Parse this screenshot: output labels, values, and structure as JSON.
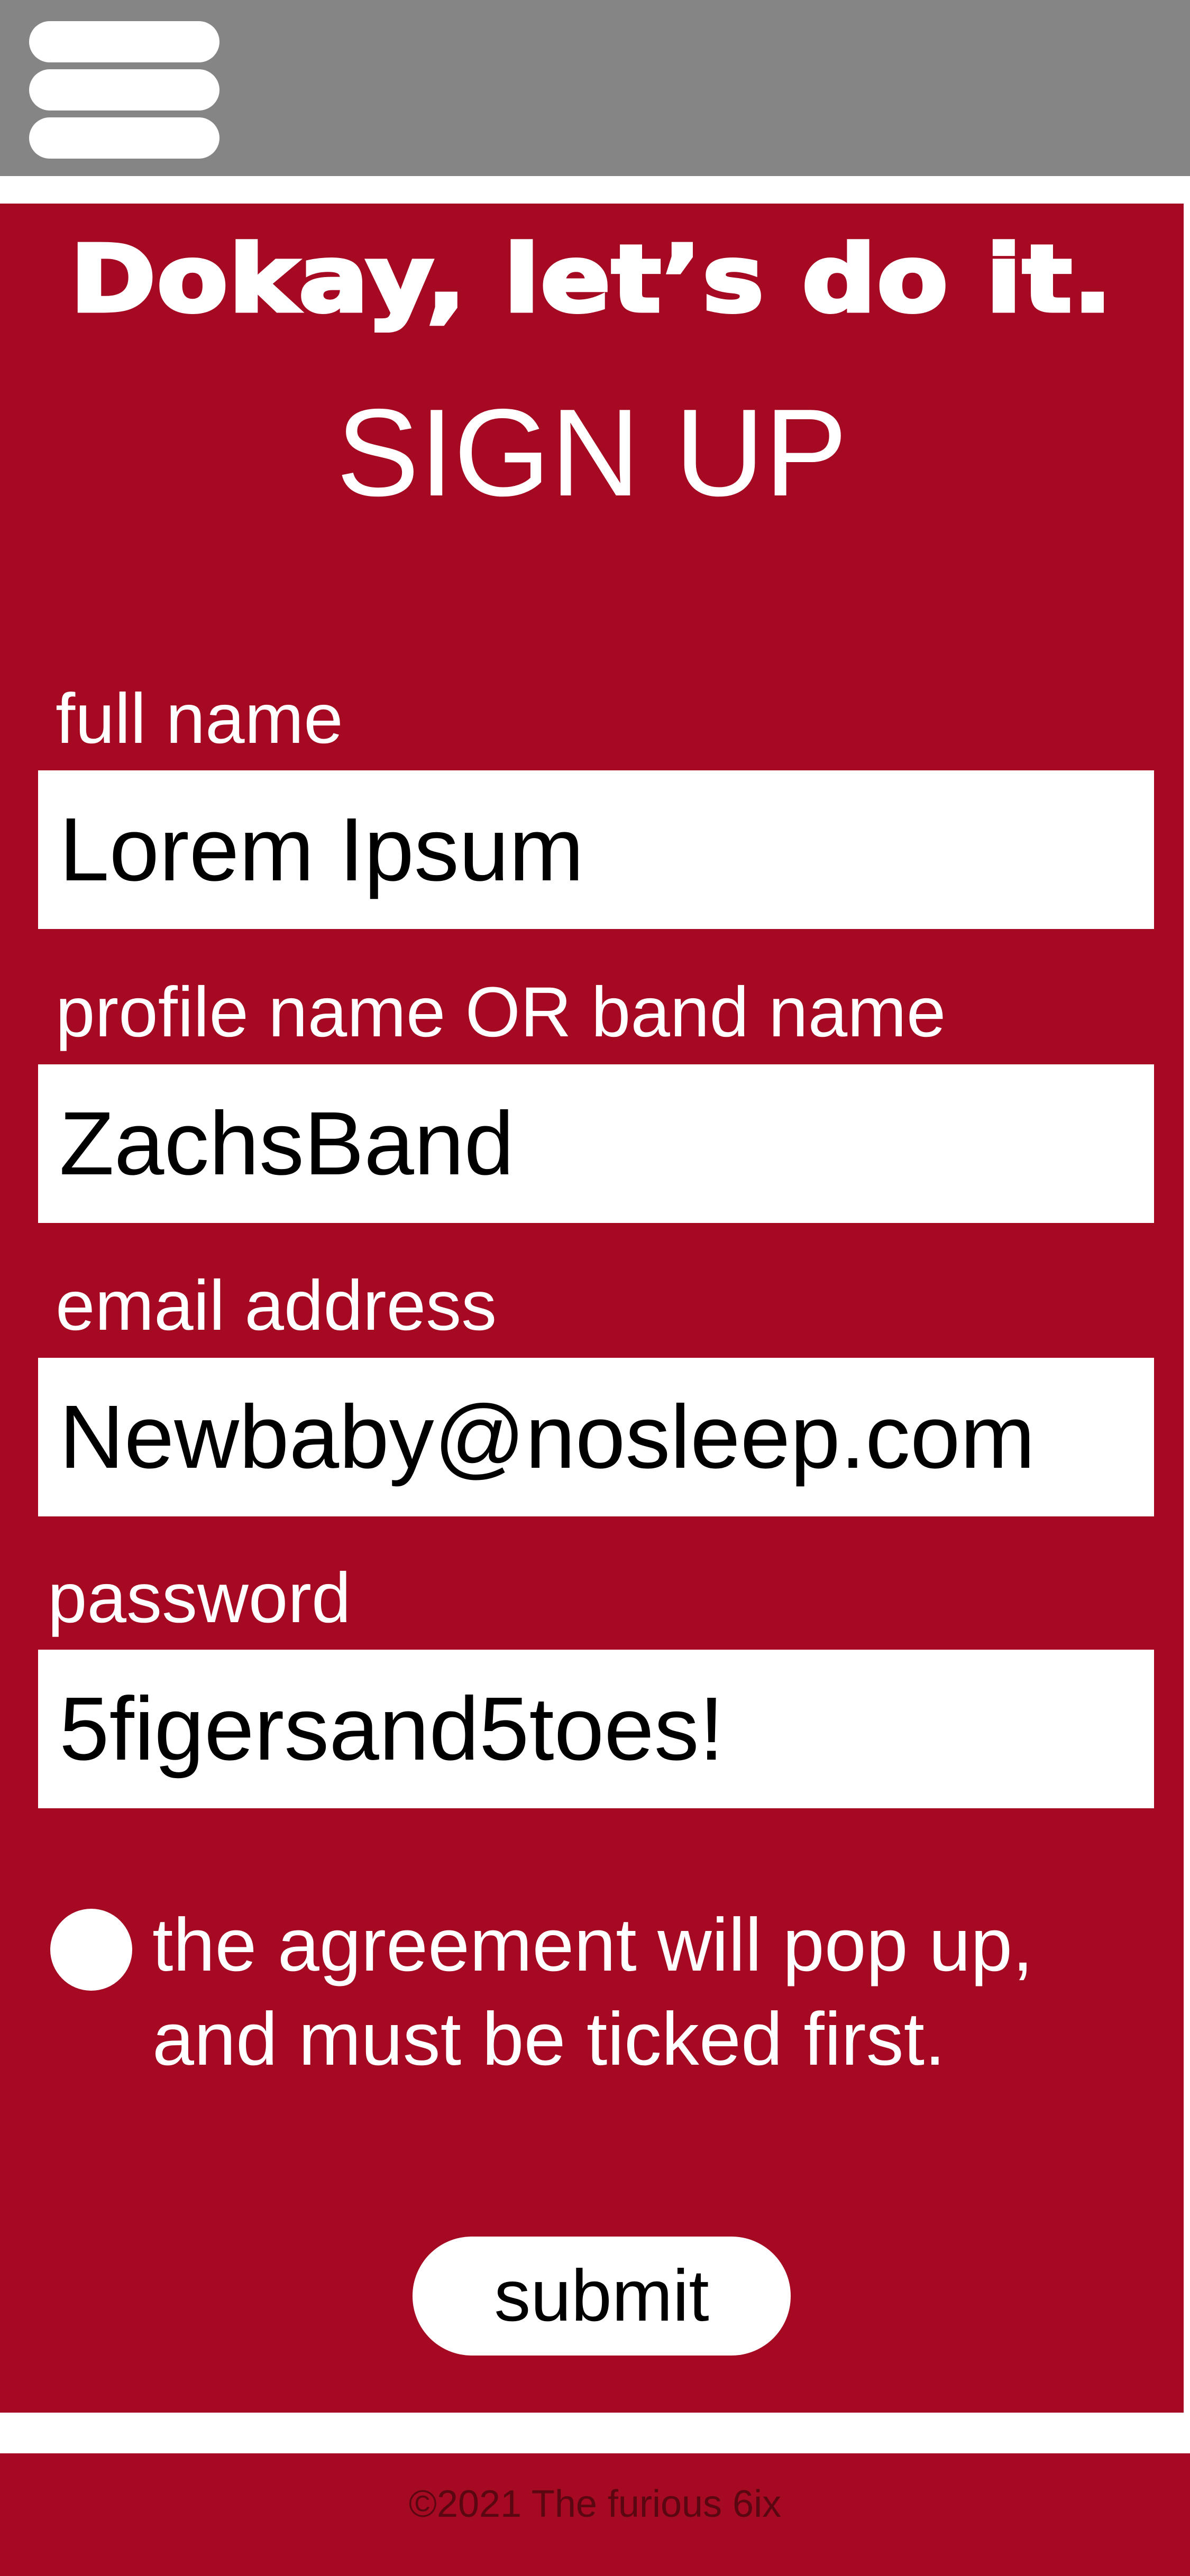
{
  "colors": {
    "topbar": "#858585",
    "primary": "#a60922",
    "white": "#ffffff",
    "footer_text": "#5a0712"
  },
  "header": {
    "menu_icon": "hamburger-menu-icon"
  },
  "form": {
    "heading": "Dokay, let’s do it.",
    "title": "SIGN UP",
    "fields": [
      {
        "label": "full name",
        "value": "Lorem Ipsum"
      },
      {
        "label": "profile name OR band name",
        "value": "ZachsBand"
      },
      {
        "label": "email address",
        "value": "Newbaby@nosleep.com"
      },
      {
        "label": "password",
        "value": "5figersand5toes!"
      }
    ],
    "agreement_line1": "the agreement will pop up,",
    "agreement_line2": "and must be ticked first.",
    "agreement_checked": false,
    "submit_label": "submit"
  },
  "footer": {
    "copyright": "©2021 The furious 6ix"
  }
}
